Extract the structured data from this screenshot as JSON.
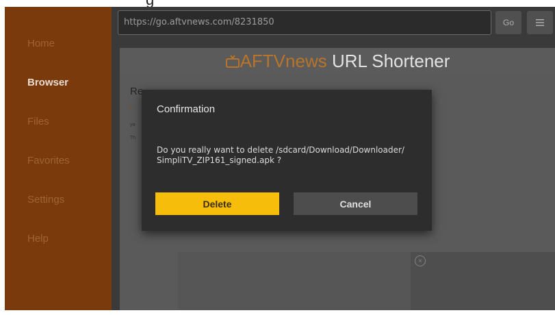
{
  "top_strip_text": "g",
  "sidebar": {
    "items": [
      {
        "label": "Home",
        "active": false
      },
      {
        "label": "Browser",
        "active": true
      },
      {
        "label": "Files",
        "active": false
      },
      {
        "label": "Favorites",
        "active": false
      },
      {
        "label": "Settings",
        "active": false
      },
      {
        "label": "Help",
        "active": false
      }
    ]
  },
  "toolbar": {
    "url_value": "https://go.aftvnews.com/8231850",
    "go_label": "Go",
    "menu_icon": "menu-icon"
  },
  "webpage": {
    "brand_prefix": "AFTVnews",
    "title_suffix": " URL Shortener",
    "heading_fragment": "Re",
    "small_line_1": "h",
    "small_line_2": "yo",
    "small_line_3": "Th",
    "ad_close_icon": "close-circle-icon"
  },
  "dialog": {
    "title": "Confirmation",
    "message_line_1": "Do you really want to delete /sdcard/Download/Downloader/",
    "message_line_2": "SimpliTV_ZIP161_signed.apk ?",
    "delete_label": "Delete",
    "cancel_label": "Cancel"
  },
  "colors": {
    "sidebar_bg": "#7a3a0c",
    "accent_yellow": "#f6bd0b",
    "brand_orange": "#b8742a"
  }
}
